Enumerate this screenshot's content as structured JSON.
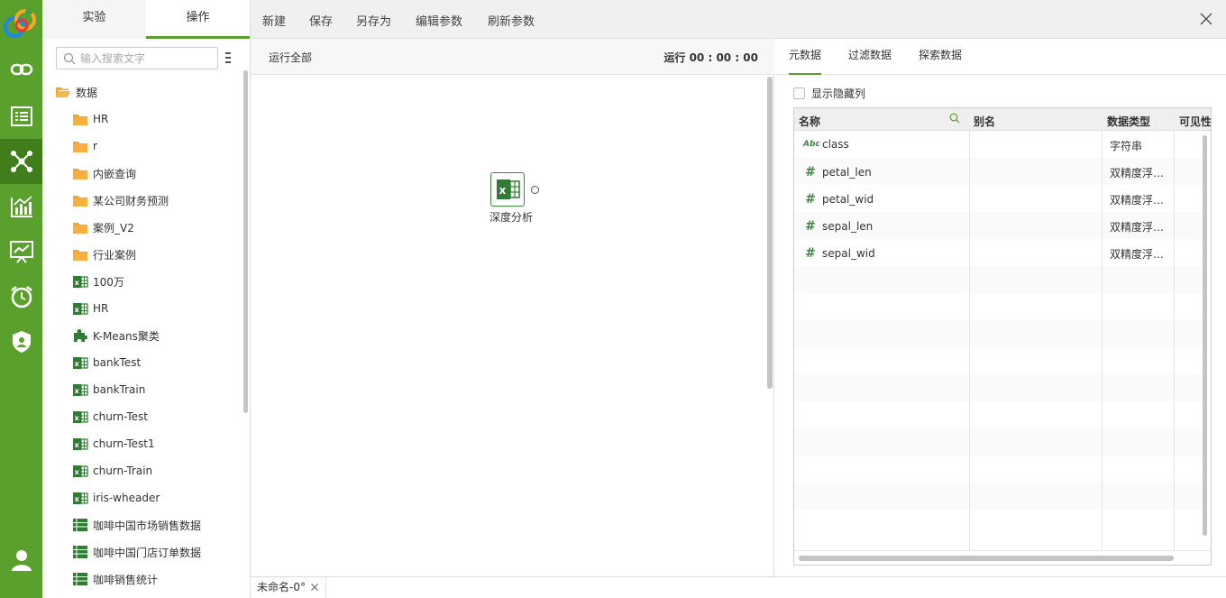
{
  "colors": {
    "nav_green": "#5aa02c",
    "nav_active": "#3f7e1a",
    "accent": "#5aa02c",
    "icon_green": "#2e7d32",
    "folder": "#f5a623"
  },
  "nav": {
    "items": [
      {
        "name": "link-icon"
      },
      {
        "name": "list-icon"
      },
      {
        "name": "network-icon",
        "active": true
      },
      {
        "name": "chart-icon"
      },
      {
        "name": "presentation-icon"
      },
      {
        "name": "alarm-clock-icon"
      },
      {
        "name": "shield-icon"
      },
      {
        "name": "user-icon"
      }
    ]
  },
  "tree": {
    "tabs": [
      "实验",
      "操作"
    ],
    "active_tab": "操作",
    "search_placeholder": "输入搜索文字",
    "items": [
      {
        "label": "数据",
        "icon": "folder-open-icon",
        "level": 0
      },
      {
        "label": "HR",
        "icon": "folder-icon",
        "level": 1
      },
      {
        "label": "r",
        "icon": "folder-icon",
        "level": 1
      },
      {
        "label": "内嵌查询",
        "icon": "folder-icon",
        "level": 1
      },
      {
        "label": "某公司财务预测",
        "icon": "folder-icon",
        "level": 1
      },
      {
        "label": "案例_V2",
        "icon": "folder-icon",
        "level": 1
      },
      {
        "label": "行业案例",
        "icon": "folder-icon",
        "level": 1
      },
      {
        "label": "100万",
        "icon": "excel-icon",
        "level": 1
      },
      {
        "label": "HR",
        "icon": "excel-icon",
        "level": 1
      },
      {
        "label": "K-Means聚类",
        "icon": "puzzle-icon",
        "level": 1
      },
      {
        "label": "bankTest",
        "icon": "excel-icon",
        "level": 1
      },
      {
        "label": "bankTrain",
        "icon": "excel-icon",
        "level": 1
      },
      {
        "label": "churn-Test",
        "icon": "excel-icon",
        "level": 1
      },
      {
        "label": "churn-Test1",
        "icon": "excel-icon",
        "level": 1
      },
      {
        "label": "churn-Train",
        "icon": "excel-icon",
        "level": 1
      },
      {
        "label": "iris-wheader",
        "icon": "excel-icon",
        "level": 1
      },
      {
        "label": "咖啡中国市场销售数据",
        "icon": "table-icon",
        "level": 1
      },
      {
        "label": "咖啡中国门店订单数据",
        "icon": "table-icon",
        "level": 1
      },
      {
        "label": "咖啡销售统计",
        "icon": "table-icon",
        "level": 1
      }
    ]
  },
  "toolbar": {
    "new_label": "新建",
    "save_label": "保存",
    "save_as_label": "另存为",
    "edit_params_label": "编辑参数",
    "refresh_params_label": "刷新参数"
  },
  "canvas": {
    "run_all_label": "运行全部",
    "run_time": "运行 00 : 00 : 00",
    "node_label": "深度分析"
  },
  "bottom": {
    "tab_label": "未命名-0°"
  },
  "props": {
    "tabs": [
      "元数据",
      "过滤数据",
      "探索数据"
    ],
    "active_tab": "元数据",
    "show_hidden_label": "显示隐藏列",
    "columns": [
      "名称",
      "别名",
      "数据类型",
      "可见性"
    ],
    "rows": [
      {
        "icon": "Abc",
        "name": "class",
        "type": "字符串"
      },
      {
        "icon": "#",
        "name": "petal_len",
        "type": "双精度浮…"
      },
      {
        "icon": "#",
        "name": "petal_wid",
        "type": "双精度浮…"
      },
      {
        "icon": "#",
        "name": "sepal_len",
        "type": "双精度浮…"
      },
      {
        "icon": "#",
        "name": "sepal_wid",
        "type": "双精度浮…"
      }
    ]
  }
}
